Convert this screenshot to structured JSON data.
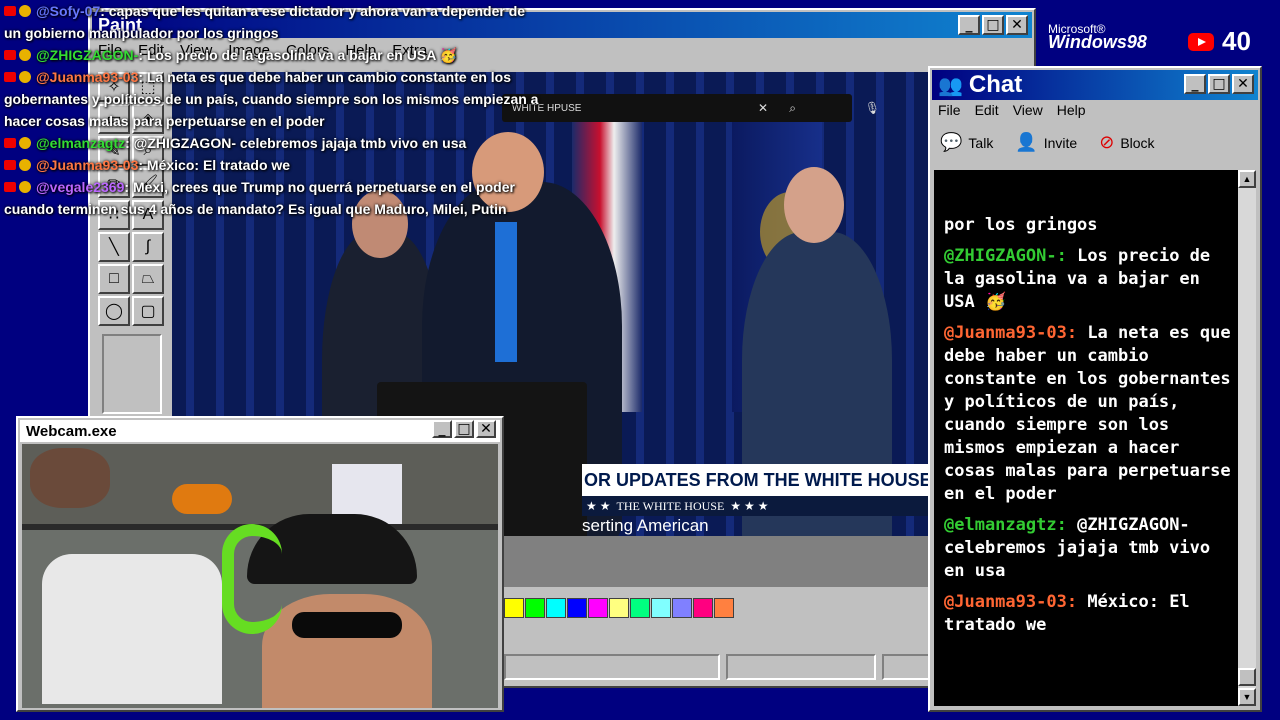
{
  "desktop": {
    "brand": {
      "line1": "Microsoft®",
      "line2": "Windows98"
    },
    "viewer_count": "40"
  },
  "paint": {
    "title": "Paint",
    "menu": [
      "File",
      "Edit",
      "View",
      "Image",
      "Colors",
      "Help",
      "Extra"
    ],
    "video": {
      "search_text": "WHITE HPUSE",
      "lower_third": "OR UPDATES FROM THE WHITE HOUSE",
      "network": "THE WHITE HOUSE",
      "caption": "serting American"
    },
    "palette": [
      "#ffff00",
      "#00ff00",
      "#00ffff",
      "#0000ff",
      "#ff00ff",
      "#ffff80",
      "#00ff80",
      "#80ffff",
      "#8080ff",
      "#ff0080",
      "#ff8040"
    ]
  },
  "chat": {
    "title": "Chat",
    "menu": [
      "File",
      "Edit",
      "View",
      "Help"
    ],
    "tools": [
      {
        "icon": "talk-icon",
        "label": "Talk"
      },
      {
        "icon": "invite-icon",
        "label": "Invite"
      },
      {
        "icon": "block-icon",
        "label": "Block"
      }
    ],
    "messages": [
      {
        "user": "",
        "text": "por los gringos",
        "color": "#ffffff"
      },
      {
        "user": "@ZHIGZAGON-:",
        "text": "Los precio de la gasolina va a bajar en USA 🥳",
        "color": "#33cc33"
      },
      {
        "user": "@Juanma93-03:",
        "text": "La neta es que debe haber un cambio constante en los gobernantes y políticos de un país, cuando siempre son los mismos empiezan a hacer cosas malas para perpetuarse en el poder",
        "color": "#ff6633"
      },
      {
        "user": "@elmanzagtz:",
        "text": "@ZHIGZAGON- celebremos jajaja tmb vivo en usa",
        "color": "#33cc33"
      },
      {
        "user": "@Juanma93-03:",
        "text": "México: El tratado we",
        "color": "#ff6633"
      }
    ]
  },
  "webcam": {
    "title": "Webcam.exe"
  },
  "overlay_chat": [
    {
      "user": "@Sofy-07",
      "text": ": capas que les quitan a ese dictador y ahora van a depender de un gobierno manipulador por los gringos",
      "color": "#6677ff"
    },
    {
      "user": "@ZHIGZAGON-",
      "text": ": Los precio de la gasolina va a bajar en USA 🥳",
      "color": "#33dd33"
    },
    {
      "user": "@Juanma93-03",
      "text": ": La neta es que debe haber un cambio constante en los gobernantes y políticos de un país, cuando siempre son los mismos empiezan a hacer cosas malas para perpetuarse en el poder",
      "color": "#ff7744"
    },
    {
      "user": "@elmanzagtz",
      "text": ": @ZHIGZAGON- celebremos jajaja tmb vivo en usa",
      "color": "#33dd33"
    },
    {
      "user": "@Juanma93-03",
      "text": ": México: El tratado we",
      "color": "#ff7744"
    },
    {
      "user": "@vegale2369",
      "text": ": Mexi, crees que Trump no querrá perpetuarse en el poder cuando terminen sus 4 años de mandato? Es igual que Maduro, Milei, Putin",
      "color": "#bb66ff"
    }
  ]
}
